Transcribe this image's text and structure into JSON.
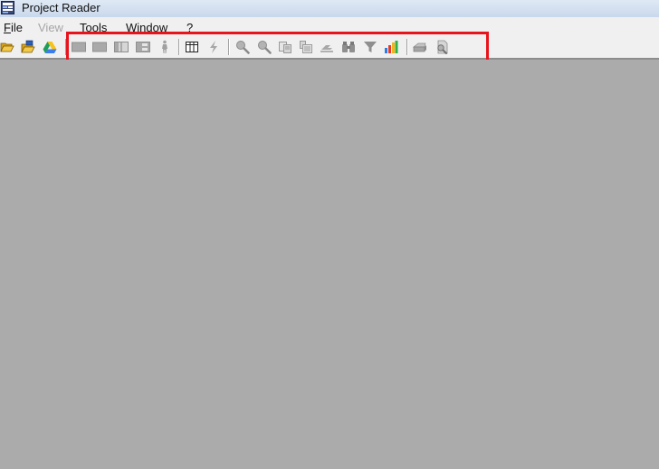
{
  "window": {
    "title": "Project Reader"
  },
  "menu": {
    "file": {
      "first": "F",
      "rest": "ile"
    },
    "view": {
      "label": "View"
    },
    "tools": {
      "first": "T",
      "rest": "ools"
    },
    "window": {
      "first": "W",
      "rest": "indow"
    },
    "help": {
      "label": "?"
    }
  },
  "toolbar": {
    "icons": [
      "open-folder-icon",
      "open-project-icon",
      "google-drive-icon",
      "gantt-view-icon",
      "task-sheet-icon",
      "column-view-icon",
      "split-view-icon",
      "resource-person-icon",
      "table-icon",
      "lightning-icon",
      "zoom-in-icon",
      "zoom-out-icon",
      "copy-icon",
      "paste-icon",
      "goto-task-icon",
      "find-binoculars-icon",
      "filter-icon",
      "bar-chart-icon",
      "print-icon",
      "print-preview-icon"
    ]
  },
  "colors": {
    "highlight": "#e8141c",
    "workspace": "#ababab",
    "chrome": "#f0f0f0"
  }
}
